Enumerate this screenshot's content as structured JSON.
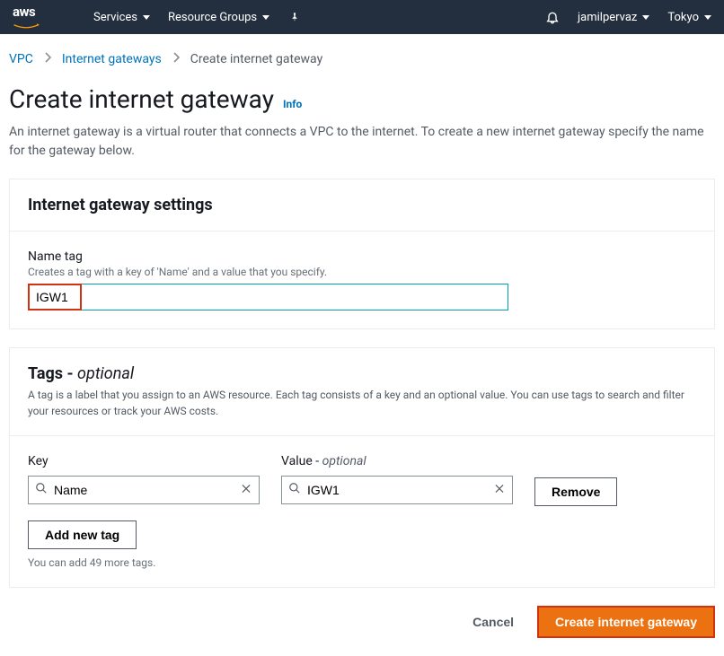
{
  "topnav": {
    "logo_text": "aws",
    "services_label": "Services",
    "resource_groups_label": "Resource Groups",
    "user_label": "jamilpervaz",
    "region_label": "Tokyo"
  },
  "breadcrumb": {
    "vpc": "VPC",
    "igw": "Internet gateways",
    "current": "Create internet gateway"
  },
  "page": {
    "title": "Create internet gateway",
    "info": "Info",
    "description": "An internet gateway is a virtual router that connects a VPC to the internet. To create a new internet gateway specify the name for the gateway below."
  },
  "settings": {
    "panel_title": "Internet gateway settings",
    "name_tag_label": "Name tag",
    "name_tag_help": "Creates a tag with a key of 'Name' and a value that you specify.",
    "name_tag_value": "IGW1"
  },
  "tags": {
    "panel_title_prefix": "Tags - ",
    "panel_title_optional": "optional",
    "panel_desc": "A tag is a label that you assign to an AWS resource. Each tag consists of a key and an optional value. You can use tags to search and filter your resources or track your AWS costs.",
    "key_label": "Key",
    "value_label_prefix": "Value - ",
    "value_label_optional": "optional",
    "key_value": "Name",
    "value_value": "IGW1",
    "remove_label": "Remove",
    "add_label": "Add new tag",
    "hint": "You can add 49 more tags."
  },
  "footer": {
    "cancel": "Cancel",
    "create": "Create internet gateway"
  }
}
